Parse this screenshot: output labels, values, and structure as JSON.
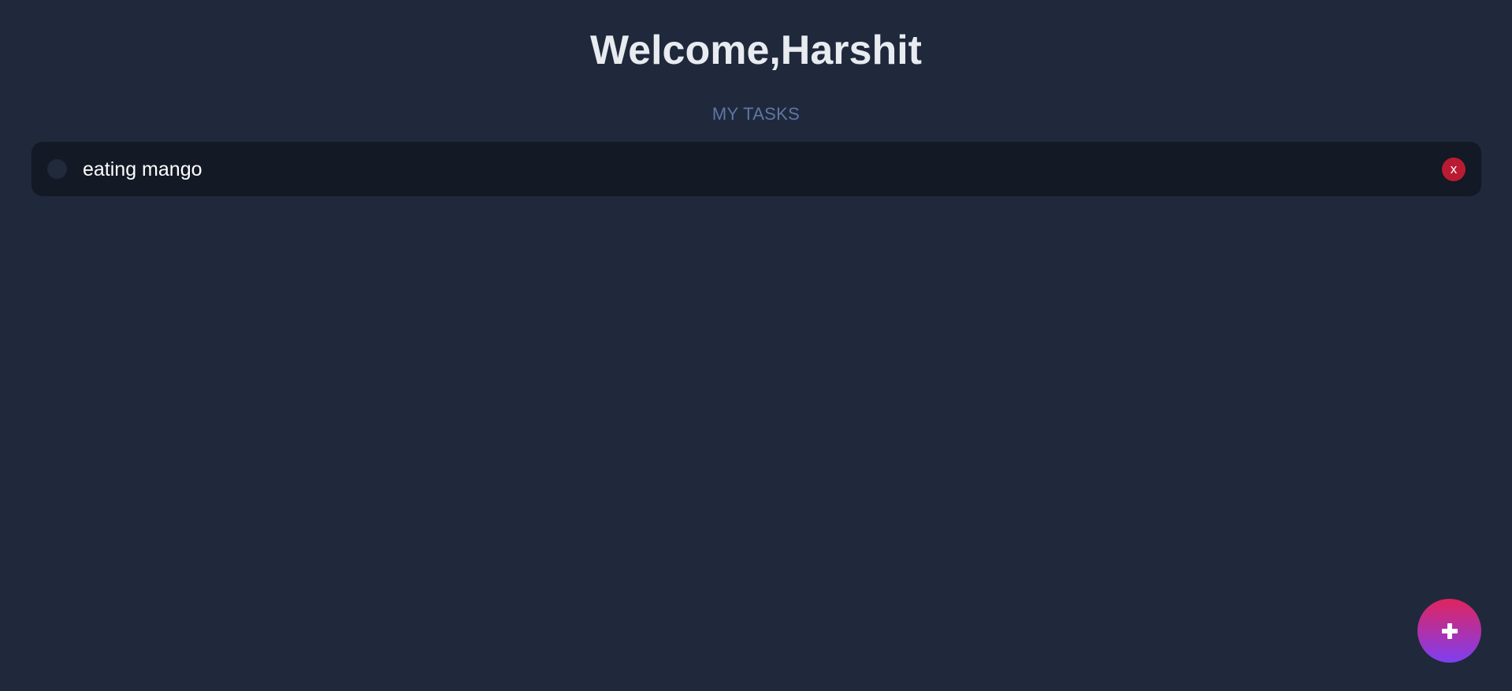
{
  "header": {
    "title": "Welcome,Harshit",
    "subtitle": "MY TASKS"
  },
  "tasks": [
    {
      "text": "eating mango",
      "completed": false,
      "delete_label": "x"
    }
  ],
  "fab": {
    "icon": "plus-icon"
  },
  "colors": {
    "background": "#1f293b",
    "task_background": "#131925",
    "subtitle": "#5f75a4",
    "delete_button": "#b91c32",
    "fab_gradient_start": "#e0245e",
    "fab_gradient_end": "#7e3ff2"
  }
}
